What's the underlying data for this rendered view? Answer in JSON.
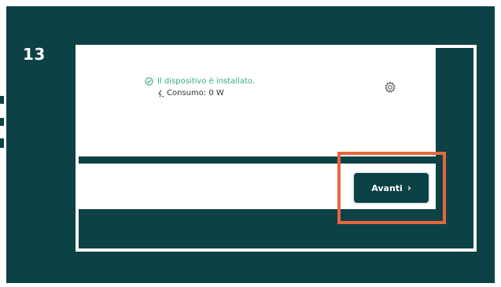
{
  "tutorial": {
    "step_number": "13"
  },
  "device_panel": {
    "status_text": "Il dispositivo è installato.",
    "consumption_text": "Consumo: 0 W",
    "icons": {
      "status": "check-circle-icon",
      "consumption": "lightning-bolt-icon",
      "settings": "gear-icon"
    }
  },
  "footer": {
    "next_label": "Avanti",
    "next_icon": "chevron-right-icon"
  },
  "colors": {
    "background": "#0c4146",
    "accent_green": "#3aa889",
    "highlight": "#e8663e"
  }
}
